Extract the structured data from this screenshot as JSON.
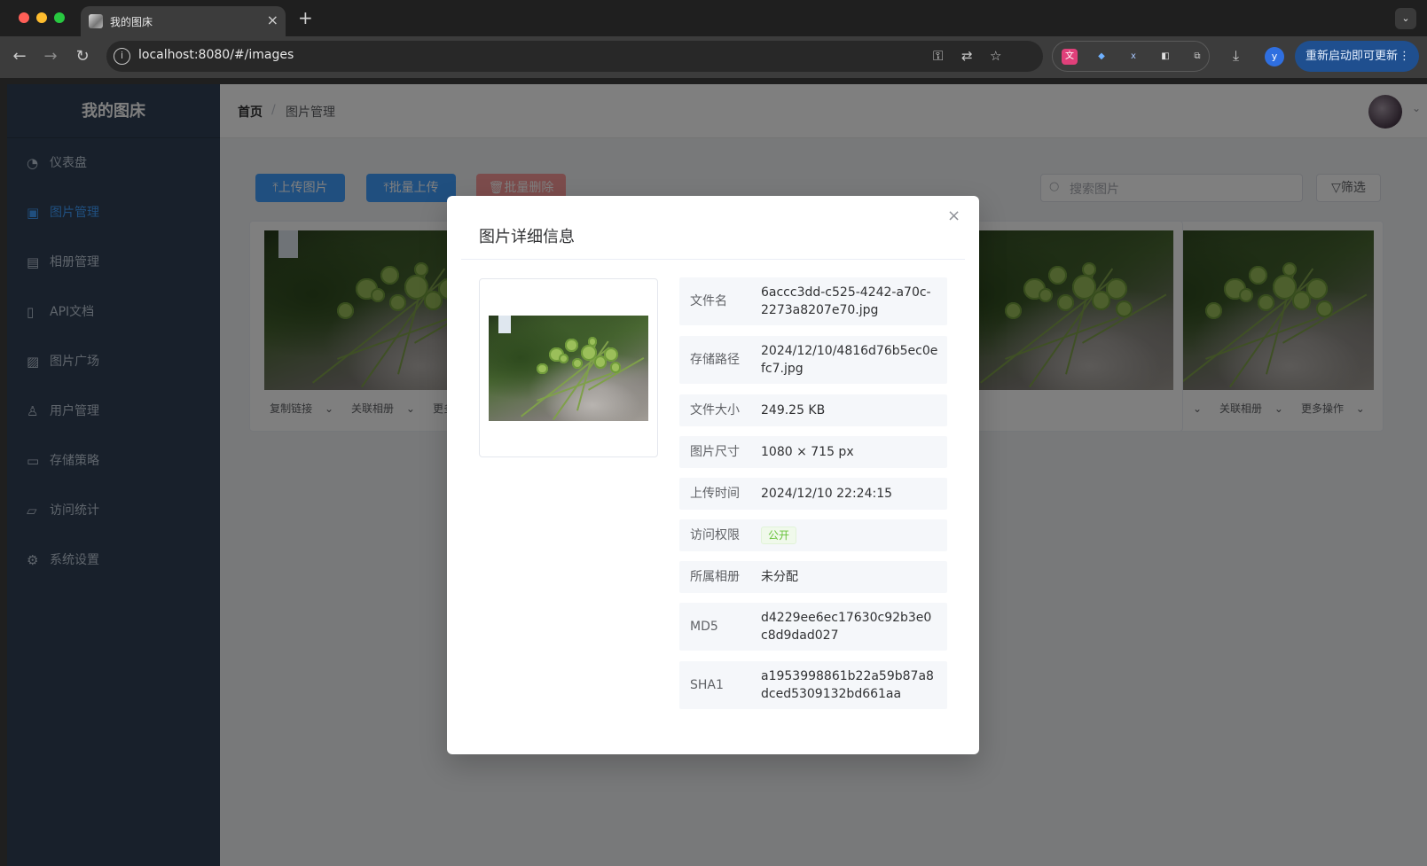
{
  "browser": {
    "tab_title": "我的图床",
    "url": "localhost:8080/#/images",
    "update_label": "重新启动即可更新",
    "profile_initial": "y"
  },
  "app": {
    "logo": "我的图床",
    "menu": [
      {
        "label": "仪表盘",
        "icon": "gauge-icon",
        "active": false
      },
      {
        "label": "图片管理",
        "icon": "picture-icon",
        "active": true
      },
      {
        "label": "相册管理",
        "icon": "album-icon",
        "active": false
      },
      {
        "label": "API文档",
        "icon": "document-icon",
        "active": false
      },
      {
        "label": "图片广场",
        "icon": "gallery-icon",
        "active": false
      },
      {
        "label": "用户管理",
        "icon": "user-icon",
        "active": false
      },
      {
        "label": "存储策略",
        "icon": "folder-icon",
        "active": false
      },
      {
        "label": "访问统计",
        "icon": "chart-icon",
        "active": false
      },
      {
        "label": "系统设置",
        "icon": "gear-icon",
        "active": false
      }
    ],
    "breadcrumb": {
      "home": "首页",
      "current": "图片管理"
    },
    "toolbar": {
      "upload": "上传图片",
      "batch_upload": "批量上传",
      "batch_delete": "批量删除",
      "search_placeholder": "搜索图片",
      "filter": "筛选"
    },
    "card_actions": {
      "copy": "复制链接",
      "album": "关联相册",
      "more": "更多操作"
    }
  },
  "dialog": {
    "title": "图片详细信息",
    "rows": [
      {
        "label": "文件名",
        "value": "6accc3dd-c525-4242-a70c-2273a8207e70.jpg"
      },
      {
        "label": "存储路径",
        "value": "2024/12/10/4816d76b5ec0efc7.jpg"
      },
      {
        "label": "文件大小",
        "value": "249.25 KB"
      },
      {
        "label": "图片尺寸",
        "value": "1080 × 715 px"
      },
      {
        "label": "上传时间",
        "value": "2024/12/10 22:24:15"
      },
      {
        "label": "访问权限",
        "value": "公开"
      },
      {
        "label": "所属相册",
        "value": "未分配"
      },
      {
        "label": "MD5",
        "value": "d4229ee6ec17630c92b3e0c8d9dad027"
      },
      {
        "label": "SHA1",
        "value": "a1953998861b22a59b87a8dced5309132bd661aa"
      }
    ]
  }
}
